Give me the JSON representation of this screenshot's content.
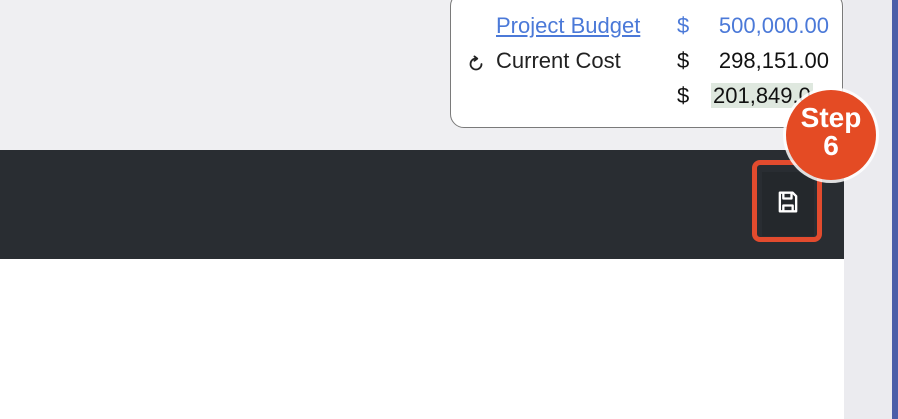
{
  "budget_summary": {
    "project_budget": {
      "label": "Project Budget",
      "currency": "$",
      "amount": "500,000.00"
    },
    "current_cost": {
      "label": "Current Cost",
      "currency": "$",
      "amount": "298,151.00"
    },
    "remaining": {
      "currency": "$",
      "amount_visible": "201,849.0"
    }
  },
  "toolbar": {
    "save_icon": "save-icon"
  },
  "callout": {
    "step_word": "Step",
    "step_number": "6"
  },
  "colors": {
    "link_blue": "#4b79d8",
    "toolbar_dark": "#292d32",
    "accent_red": "#e24b2e",
    "remaining_highlight": "#dfe8df"
  }
}
